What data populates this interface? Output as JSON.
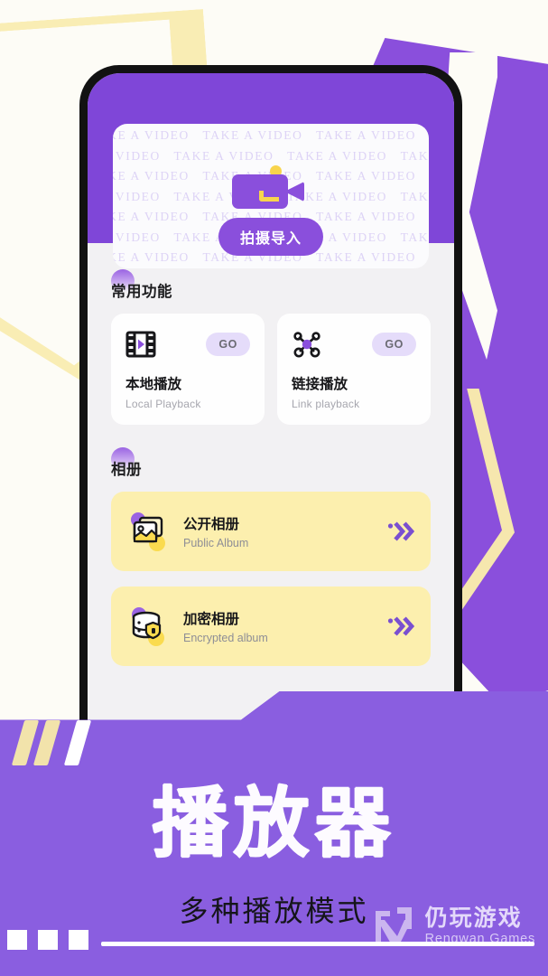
{
  "colors": {
    "purple": "#8a4fdc",
    "purple_banner": "#8a5ee0",
    "yellow": "#f9edb4",
    "card_yellow": "#fcefae",
    "accent_yellow": "#f8d44c",
    "screen_bg": "#f2f1f3",
    "page_bg": "#fdfcf6"
  },
  "phone": {
    "hero": {
      "watermark_text": "TAKE A VIDEO",
      "camera_icon": "video-camera-icon",
      "button_label": "拍摄导入"
    },
    "sections": [
      {
        "id": "common-functions",
        "title": "常用功能",
        "cards": [
          {
            "icon": "film-strip-play-icon",
            "badge": "GO",
            "title": "本地播放",
            "subtitle": "Local Playback"
          },
          {
            "icon": "network-nodes-icon",
            "badge": "GO",
            "title": "链接播放",
            "subtitle": "Link playback"
          }
        ]
      },
      {
        "id": "albums",
        "title": "相册",
        "rows": [
          {
            "icon": "photo-stack-icon",
            "title": "公开相册",
            "subtitle": "Public Album",
            "arrow": "double-chevron-right-icon"
          },
          {
            "icon": "encrypted-database-lock-icon",
            "title": "加密相册",
            "subtitle": "Encrypted album",
            "arrow": "double-chevron-right-icon"
          }
        ]
      }
    ]
  },
  "banner": {
    "title": "播放器",
    "subtitle": "多种播放模式",
    "logo": {
      "mark": "rengwan-logo-mark",
      "cn": "仍玩游戏",
      "en": "Rengwan Games"
    }
  }
}
